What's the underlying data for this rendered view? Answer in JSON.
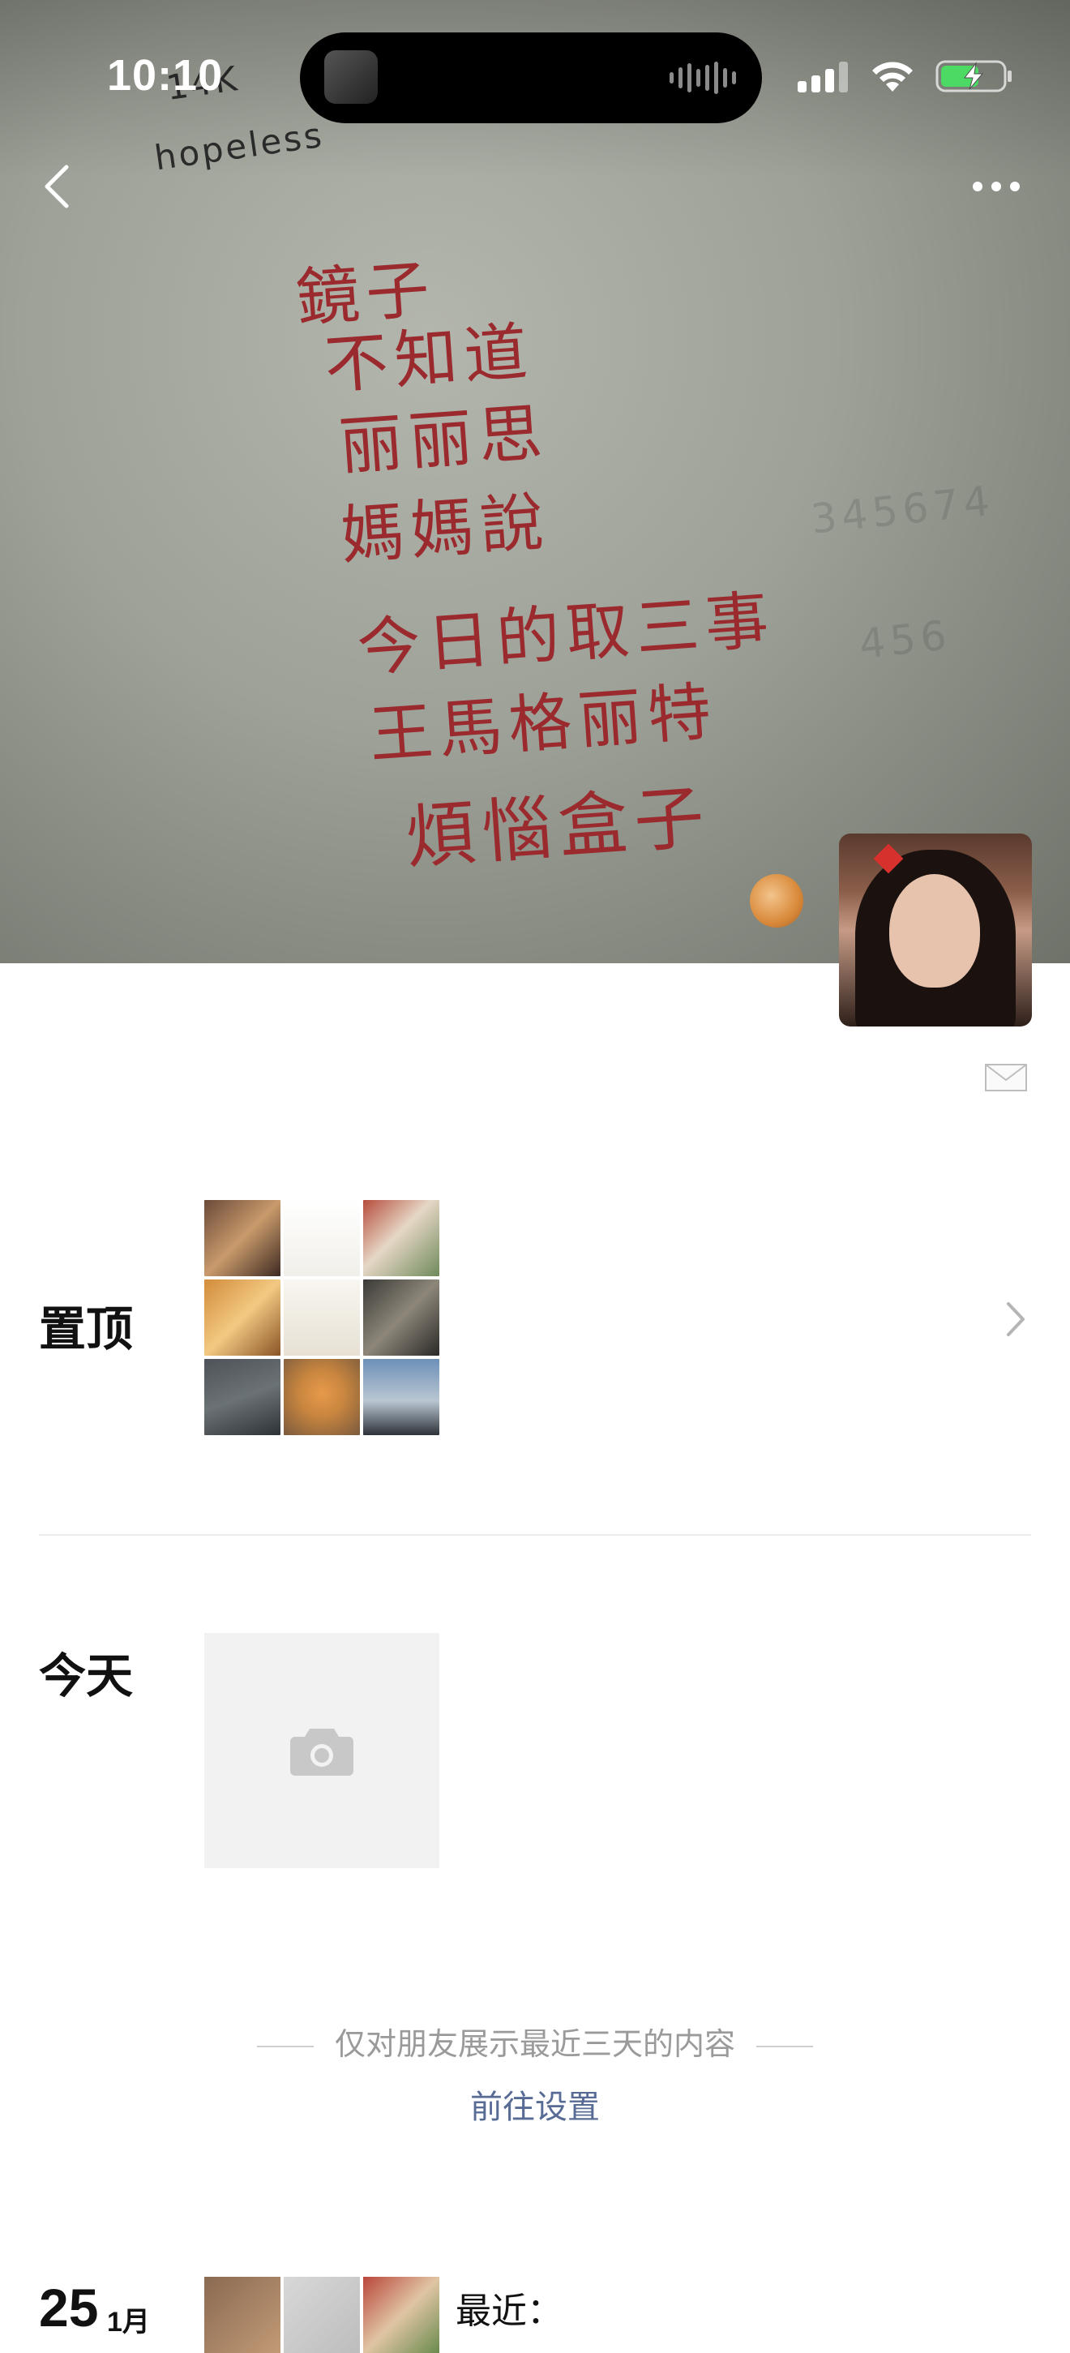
{
  "status_bar": {
    "time": "10:10"
  },
  "cover": {
    "handwriting_lines": [
      "鏡子",
      "不知道",
      "丽丽思",
      "媽媽說",
      "今日的取三事",
      "王馬格丽特",
      "煩惱盒子"
    ],
    "top_words": [
      "14K",
      "hopeless"
    ],
    "faint_text": [
      "345674",
      "456"
    ]
  },
  "sections": {
    "pinned_label": "置顶",
    "today_label": "今天"
  },
  "notice": {
    "text": "仅对朋友展示最近三天的内容",
    "settings_link": "前往设置"
  },
  "entry": {
    "day": "25",
    "month": "1月",
    "caption": "最近："
  },
  "colors": {
    "link": "#576b95",
    "ink": "#9b2a2e",
    "battery": "#4cd964"
  },
  "icons": [
    "back-icon",
    "more-icon",
    "camera-icon",
    "chevron-right-icon",
    "mail-icon",
    "wifi-icon",
    "cellular-icon",
    "battery-icon"
  ]
}
